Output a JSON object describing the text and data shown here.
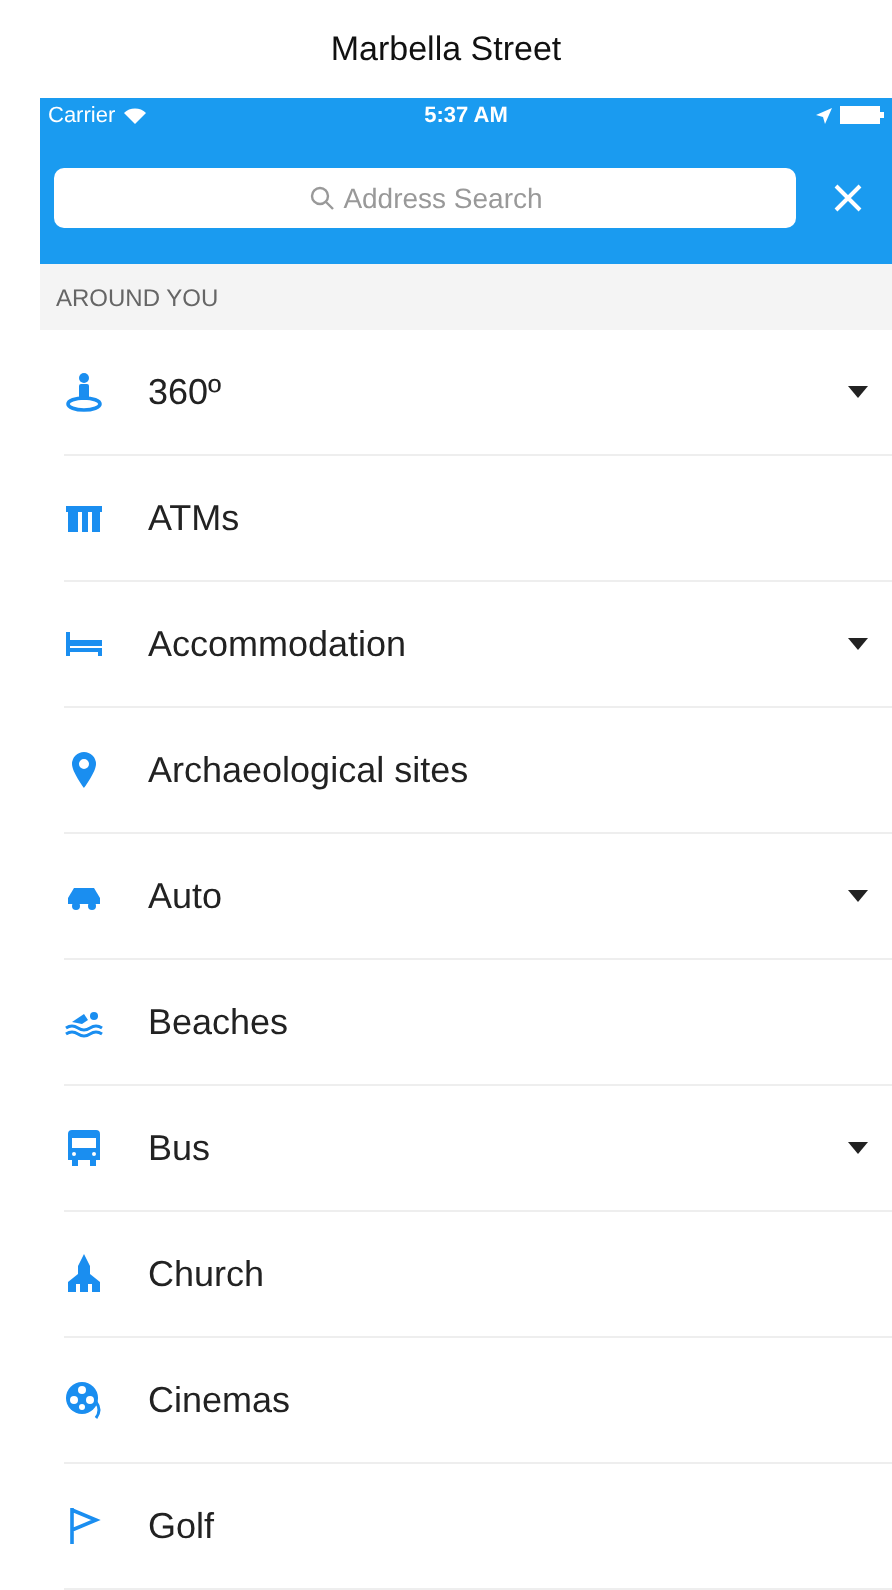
{
  "page_title": "Marbella Street",
  "status_bar": {
    "carrier": "Carrier",
    "time": "5:37 AM"
  },
  "search": {
    "placeholder": "Address Search"
  },
  "section": {
    "title": "AROUND YOU"
  },
  "items": [
    {
      "label": "360º",
      "expandable": true
    },
    {
      "label": "ATMs",
      "expandable": false
    },
    {
      "label": "Accommodation",
      "expandable": true
    },
    {
      "label": "Archaeological sites",
      "expandable": false
    },
    {
      "label": "Auto",
      "expandable": true
    },
    {
      "label": "Beaches",
      "expandable": false
    },
    {
      "label": "Bus",
      "expandable": true
    },
    {
      "label": "Church",
      "expandable": false
    },
    {
      "label": "Cinemas",
      "expandable": false
    },
    {
      "label": "Golf",
      "expandable": false
    }
  ]
}
